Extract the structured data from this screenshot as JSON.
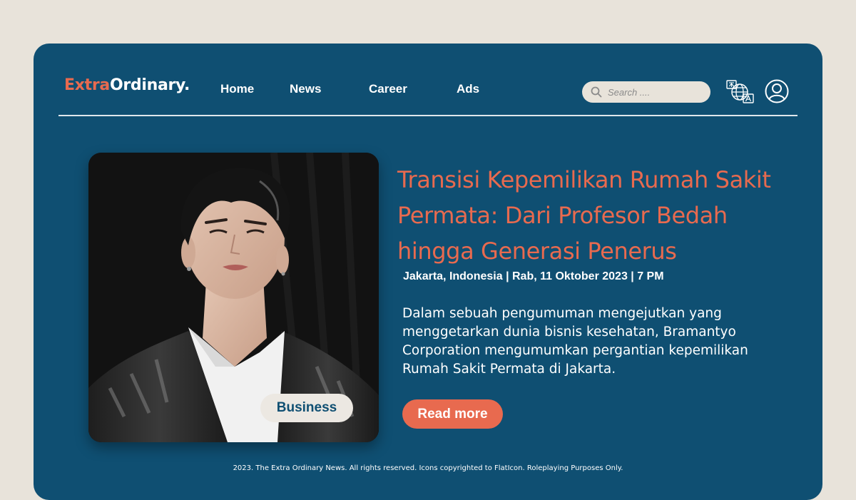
{
  "brand": {
    "part1": "Extra",
    "part2": "Ordinary."
  },
  "nav": {
    "items": [
      "Home",
      "News",
      "Career",
      "Ads"
    ]
  },
  "search": {
    "placeholder": "Search ...."
  },
  "header_icons": {
    "language": "language-globe-icon",
    "user": "user-profile-icon"
  },
  "article": {
    "image_alt": "Portrait of a young man with dark hair",
    "category": "Business",
    "title": "Transisi Kepemilikan Rumah Sakit Permata: Dari Profesor Bedah hingga Generasi Penerus",
    "meta": "Jakarta, Indonesia | Rab, 11 Oktober 2023 | 7 PM",
    "summary": "Dalam sebuah pengumuman mengejutkan yang menggetarkan dunia bisnis kesehatan, Bramantyo Corporation mengumumkan pergantian kepemilikan Rumah Sakit Permata di Jakarta.",
    "cta": "Read more"
  },
  "footer": {
    "text": "2023. The Extra Ordinary News. All rights reserved. Icons copyrighted  to FlatIcon. Roleplaying Purposes Only."
  },
  "colors": {
    "background": "#e8e3da",
    "panel": "#0f4f72",
    "accent": "#e86a4f",
    "text": "#ffffff"
  }
}
